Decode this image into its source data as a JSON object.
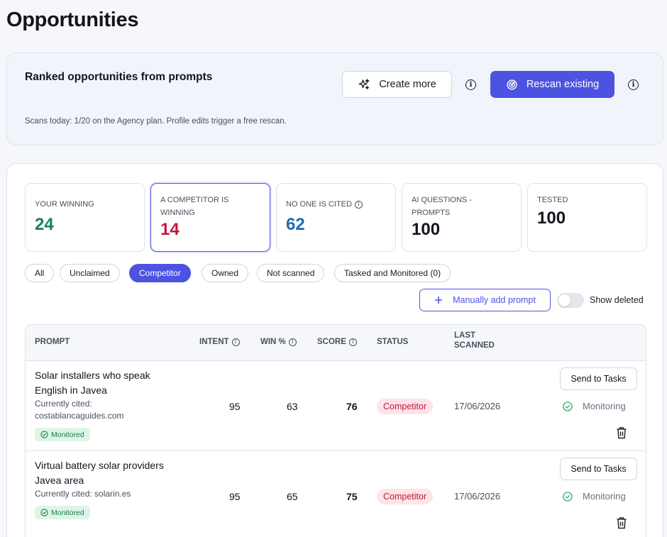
{
  "page": {
    "title": "Opportunities"
  },
  "top_card": {
    "title": "Ranked opportunities from prompts",
    "create_more_label": "Create more",
    "rescan_label": "Rescan existing",
    "subtitle": "Scans today: 1/20 on the Agency plan. Profile edits trigger a free rescan."
  },
  "stats": [
    {
      "label": "YOUR WINNING",
      "value": "24",
      "color": "#17805a"
    },
    {
      "label": "A COMPETITOR IS WINNING",
      "value": "14",
      "color": "#c2183c"
    },
    {
      "label": "NO ONE IS CITED",
      "value": "62",
      "color": "#1e6bb0"
    },
    {
      "label": "AI QUESTIONS - PROMPTS",
      "value": "100",
      "color": "#14141f"
    },
    {
      "label": "TESTED",
      "value": "100",
      "color": "#14141f"
    }
  ],
  "filters": [
    {
      "label": "All"
    },
    {
      "label": "Unclaimed"
    },
    {
      "label": "Competitor"
    },
    {
      "label": "Owned"
    },
    {
      "label": "Not scanned"
    },
    {
      "label": "Tasked and Monitored (0)"
    }
  ],
  "actions": {
    "add_prompt_label": "Manually add prompt",
    "show_deleted_label": "Show deleted"
  },
  "table": {
    "headers": {
      "prompt": "PROMPT",
      "intent": "INTENT",
      "win": "WIN %",
      "score": "SCORE",
      "status": "STATUS",
      "last_scanned_1": "LAST",
      "last_scanned_2": "SCANNED"
    },
    "rows": [
      {
        "prompt": "Solar installers who speak English in Javea",
        "cited": "Currently cited: costablancaguides.com",
        "monitored": "Monitored",
        "intent": "95",
        "win": "63",
        "score": "76",
        "status": "Competitor",
        "date": "17/06/2026",
        "send_label": "Send to Tasks",
        "monitoring_label": "Monitoring"
      },
      {
        "prompt": "Virtual battery solar providers Javea area",
        "cited": "Currently cited: solarin.es",
        "monitored": "Monitored",
        "intent": "95",
        "win": "65",
        "score": "75",
        "status": "Competitor",
        "date": "17/06/2026",
        "send_label": "Send to Tasks",
        "monitoring_label": "Monitoring"
      }
    ]
  },
  "colors": {
    "accent": "#4c53e0",
    "competitor": "#c2183c",
    "monitored": "#1f7a4a"
  },
  "icons": {
    "create_more": "sparkles-icon",
    "rescan": "radar-icon",
    "info": "info-icon",
    "add": "plus-icon",
    "check": "check-circle-icon",
    "delete": "trash-icon"
  }
}
